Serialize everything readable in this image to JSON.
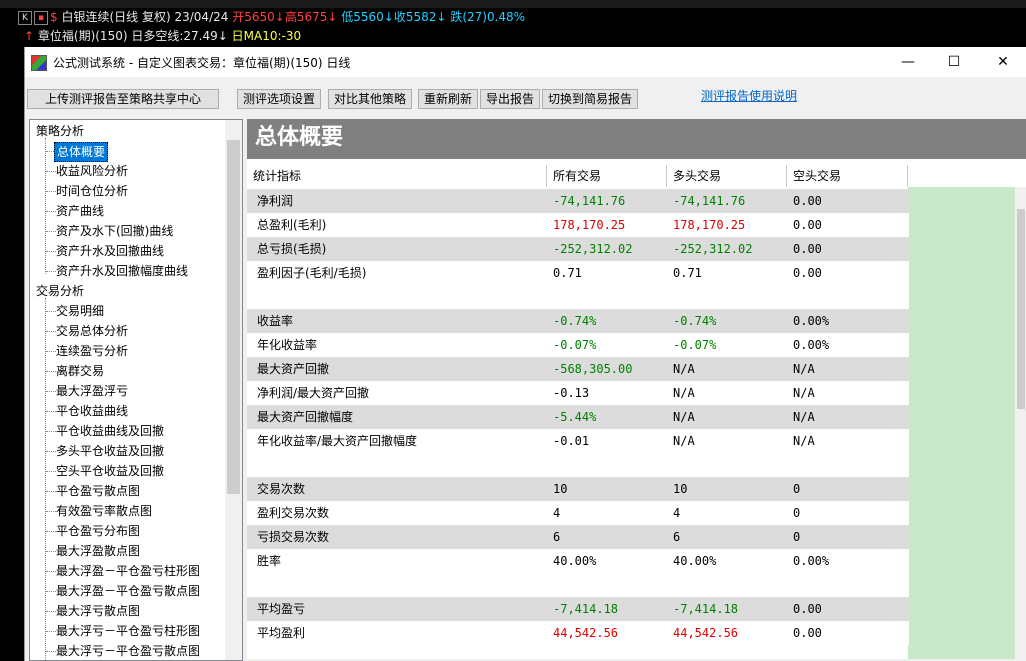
{
  "quote": {
    "k_label": "K",
    "name": "白银连续(日线 复权)",
    "date": "23/04/24",
    "open": "开5650↓",
    "high": "高5675↓",
    "low": "低5560↓",
    "close": "收5582↓",
    "change": "跌(27)0.48%",
    "line2_name": "章位福(期)(150)",
    "line2_signal": "日多空线:27.49↓",
    "line2_ma": "日MA10:-30"
  },
  "window": {
    "title": "公式测试系统 - 自定义图表交易：章位福(期)(150) 日线",
    "minimize": "—",
    "maximize": "☐",
    "close": "✕"
  },
  "toolbar": {
    "upload": "上传测评报告至策略共享中心",
    "options": "测评选项设置",
    "compare": "对比其他策略",
    "refresh": "重新刷新",
    "export": "导出报告",
    "switch": "切换到简易报告",
    "help": "测评报告使用说明"
  },
  "tree": {
    "group1": "策略分析",
    "g1_items": [
      "总体概要",
      "收益风险分析",
      "时间仓位分析",
      "资产曲线",
      "资产及水下(回撤)曲线",
      "资产升水及回撤曲线",
      "资产升水及回撤幅度曲线"
    ],
    "group2": "交易分析",
    "g2_items": [
      "交易明细",
      "交易总体分析",
      "连续盈亏分析",
      "离群交易",
      "最大浮盈浮亏",
      "平仓收益曲线",
      "平仓收益曲线及回撤",
      "多头平仓收益及回撤",
      "空头平仓收益及回撤",
      "平仓盈亏散点图",
      "有效盈亏率散点图",
      "平仓盈亏分布图",
      "最大浮盈散点图",
      "最大浮盈－平仓盈亏柱形图",
      "最大浮盈－平仓盈亏散点图",
      "最大浮亏散点图",
      "最大浮亏－平仓盈亏柱形图",
      "最大浮亏－平仓盈亏散点图"
    ]
  },
  "report": {
    "heading": "总体概要",
    "columns": [
      "统计指标",
      "所有交易",
      "多头交易",
      "空头交易"
    ],
    "rows": [
      {
        "label": "净利润",
        "all": "-74,141.76",
        "long": "-74,141.76",
        "short": "0.00",
        "shade": true,
        "color": "neg"
      },
      {
        "label": "总盈利(毛利)",
        "all": "178,170.25",
        "long": "178,170.25",
        "short": "0.00",
        "shade": false,
        "color": "pos"
      },
      {
        "label": "总亏损(毛损)",
        "all": "-252,312.02",
        "long": "-252,312.02",
        "short": "0.00",
        "shade": true,
        "color": "neg"
      },
      {
        "label": "盈利因子(毛利/毛损)",
        "all": "0.71",
        "long": "0.71",
        "short": "0.00",
        "shade": false,
        "color": ""
      },
      {
        "label": "收益率",
        "all": "-0.74%",
        "long": "-0.74%",
        "short": "0.00%",
        "shade": true,
        "color": "neg"
      },
      {
        "label": "年化收益率",
        "all": "-0.07%",
        "long": "-0.07%",
        "short": "0.00%",
        "shade": false,
        "color": "neg"
      },
      {
        "label": "最大资产回撤",
        "all": "-568,305.00",
        "long": "N/A",
        "short": "N/A",
        "shade": true,
        "color": "neg"
      },
      {
        "label": "净利润/最大资产回撤",
        "all": "-0.13",
        "long": "N/A",
        "short": "N/A",
        "shade": false,
        "color": ""
      },
      {
        "label": "最大资产回撤幅度",
        "all": "-5.44%",
        "long": "N/A",
        "short": "N/A",
        "shade": true,
        "color": "neg"
      },
      {
        "label": "年化收益率/最大资产回撤幅度",
        "all": "-0.01",
        "long": "N/A",
        "short": "N/A",
        "shade": false,
        "color": ""
      },
      {
        "label": "交易次数",
        "all": "10",
        "long": "10",
        "short": "0",
        "shade": true,
        "color": ""
      },
      {
        "label": "盈利交易次数",
        "all": "4",
        "long": "4",
        "short": "0",
        "shade": false,
        "color": ""
      },
      {
        "label": "亏损交易次数",
        "all": "6",
        "long": "6",
        "short": "0",
        "shade": true,
        "color": ""
      },
      {
        "label": "胜率",
        "all": "40.00%",
        "long": "40.00%",
        "short": "0.00%",
        "shade": false,
        "color": ""
      },
      {
        "label": "平均盈亏",
        "all": "-7,414.18",
        "long": "-7,414.18",
        "short": "0.00",
        "shade": true,
        "color": "neg"
      },
      {
        "label": "平均盈利",
        "all": "44,542.56",
        "long": "44,542.56",
        "short": "0.00",
        "shade": false,
        "color": "pos"
      }
    ]
  }
}
